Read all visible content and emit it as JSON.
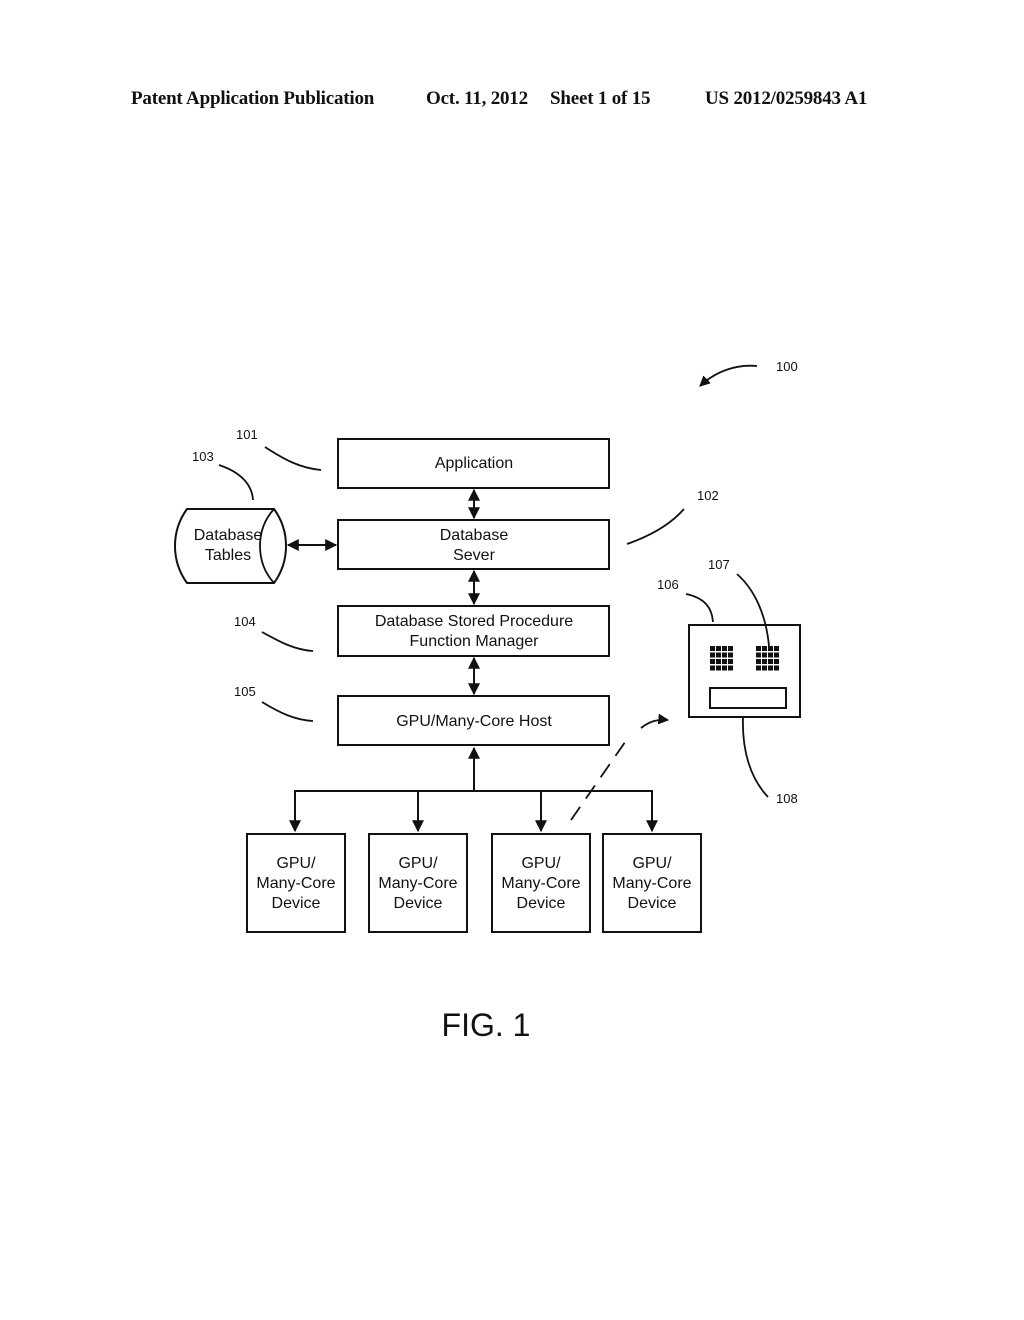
{
  "header": {
    "publication": "Patent Application Publication",
    "date": "Oct. 11, 2012",
    "sheet": "Sheet 1 of 15",
    "number": "US 2012/0259843 A1"
  },
  "diagram": {
    "system_ref": "100",
    "application": {
      "ref": "101",
      "label": "Application"
    },
    "database_server": {
      "ref": "102",
      "lines": [
        "Database",
        "Sever"
      ]
    },
    "database_tables": {
      "ref": "103",
      "lines": [
        "Database",
        "Tables"
      ]
    },
    "stored_procedure_manager": {
      "ref": "104",
      "lines": [
        "Database Stored Procedure",
        "Function Manager"
      ]
    },
    "host": {
      "ref": "105",
      "label": "GPU/Many-Core Host"
    },
    "devices": [
      {
        "lines": [
          "GPU/",
          "Many-Core",
          "Device"
        ]
      },
      {
        "lines": [
          "GPU/",
          "Many-Core",
          "Device"
        ]
      },
      {
        "lines": [
          "GPU/",
          "Many-Core",
          "Device"
        ]
      },
      {
        "lines": [
          "GPU/",
          "Many-Core",
          "Device"
        ]
      }
    ],
    "device_detail": {
      "ref": "106",
      "core_grid_ref": "107",
      "memory_ref": "108"
    }
  },
  "figure_label": "FIG. 1"
}
